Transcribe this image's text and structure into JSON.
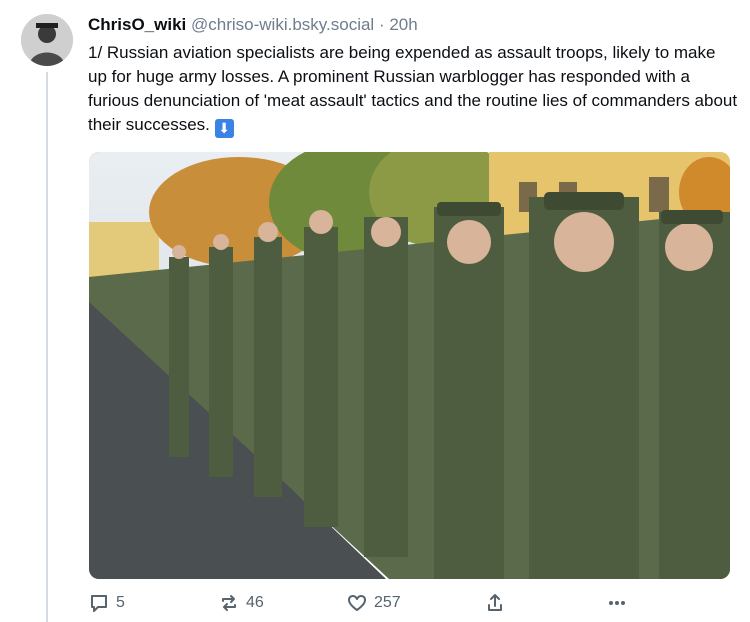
{
  "post": {
    "display_name": "ChrisO_wiki",
    "handle": "@chriso-wiki.bsky.social",
    "separator": "·",
    "time": "20h",
    "text": "1/ Russian aviation specialists are being expended as assault troops, likely to make up for huge army losses. A prominent Russian warblogger has responded with a furious denunciation of 'meat assault' tactics and the routine lies of commanders about their successes.",
    "emoji": "⬇"
  },
  "actions": {
    "replies": "5",
    "reposts": "46",
    "likes": "257"
  },
  "icons": [
    "reply-icon",
    "repost-icon",
    "like-icon",
    "share-icon",
    "more-icon"
  ]
}
